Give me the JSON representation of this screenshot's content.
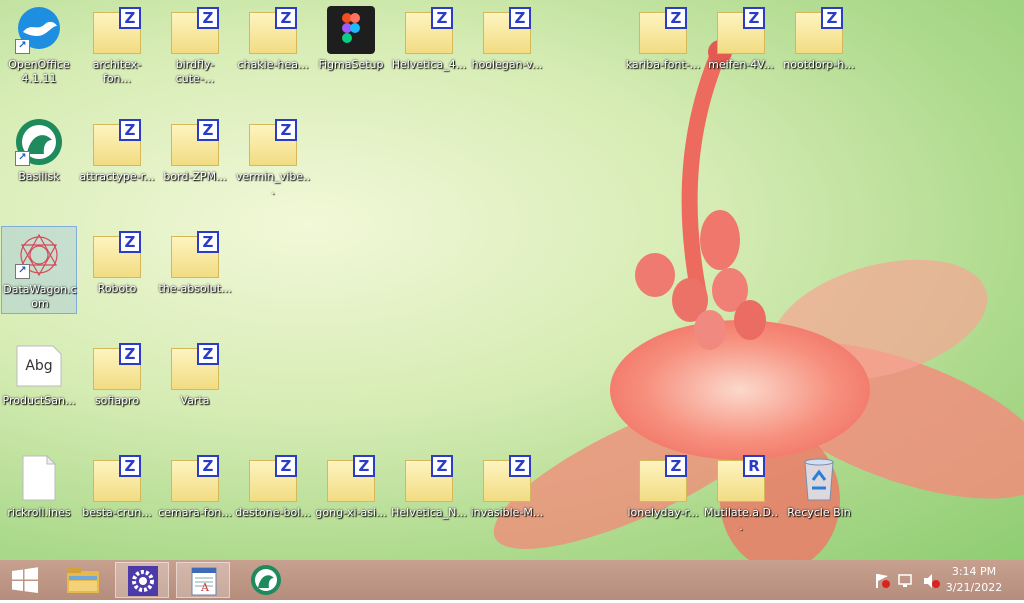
{
  "desktop": {
    "icons": [
      {
        "id": "openoffice",
        "label": "OpenOffice 4.1.11",
        "type": "app-openoffice"
      },
      {
        "id": "architex",
        "label": "architex-fon...",
        "type": "font"
      },
      {
        "id": "birdfly",
        "label": "birdfly-cute-...",
        "type": "font"
      },
      {
        "id": "chakie",
        "label": "chakie-hea...",
        "type": "font"
      },
      {
        "id": "figmasetup",
        "label": "FigmaSetup",
        "type": "app-figma"
      },
      {
        "id": "helvetica4",
        "label": "Helvetica_4...",
        "type": "font"
      },
      {
        "id": "hoolegan",
        "label": "hoolegan-v...",
        "type": "font"
      },
      {
        "id": "kariba",
        "label": "kariba-font-...",
        "type": "font"
      },
      {
        "id": "meifen",
        "label": "meifen-4V...",
        "type": "font"
      },
      {
        "id": "nootdorp",
        "label": "nootdorp-h...",
        "type": "font"
      },
      {
        "id": "basilisk",
        "label": "Basilisk",
        "type": "app-basilisk"
      },
      {
        "id": "attractype",
        "label": "attractype-r...",
        "type": "font"
      },
      {
        "id": "bord",
        "label": "bord-ZPM...",
        "type": "font"
      },
      {
        "id": "vermin",
        "label": "vermin_vibe...",
        "type": "font"
      },
      {
        "id": "datawagon",
        "label": "DataWagon.c om",
        "type": "app-datawagon"
      },
      {
        "id": "roboto",
        "label": "Roboto",
        "type": "font"
      },
      {
        "id": "theabsolut",
        "label": "the-absolut...",
        "type": "font"
      },
      {
        "id": "productsans",
        "label": "ProductSan...",
        "type": "abg"
      },
      {
        "id": "sofiapro",
        "label": "sofiapro",
        "type": "font"
      },
      {
        "id": "varta",
        "label": "Varta",
        "type": "font"
      },
      {
        "id": "rickroll",
        "label": "rickroll.ines",
        "type": "file"
      },
      {
        "id": "besta",
        "label": "besta-crun...",
        "type": "font"
      },
      {
        "id": "cemara",
        "label": "cemara-fon...",
        "type": "font"
      },
      {
        "id": "destone",
        "label": "destone-bol...",
        "type": "font"
      },
      {
        "id": "gongxi",
        "label": "gong-xi-asi...",
        "type": "font"
      },
      {
        "id": "helveticaN",
        "label": "Helvetica_N...",
        "type": "font"
      },
      {
        "id": "invasible",
        "label": "invasible-M...",
        "type": "font"
      },
      {
        "id": "lonelyday",
        "label": "lonelyday-r...",
        "type": "font"
      },
      {
        "id": "mutilate",
        "label": "Mutilate.a.D...",
        "type": "font-r"
      },
      {
        "id": "recyclebin",
        "label": "Recycle Bin",
        "type": "recycle"
      }
    ],
    "abg_text": "Abg",
    "font_badge": "Z",
    "font_badge_r": "R"
  },
  "taskbar": {
    "clock_time": "3:14 PM",
    "clock_date": "3/21/2022",
    "pinned": [
      "windows-start",
      "file-explorer",
      "settings",
      "document-viewer",
      "basilisk"
    ]
  },
  "colors": {
    "font_badge": "#2a3cc8",
    "taskbar": "#b58d7c"
  }
}
